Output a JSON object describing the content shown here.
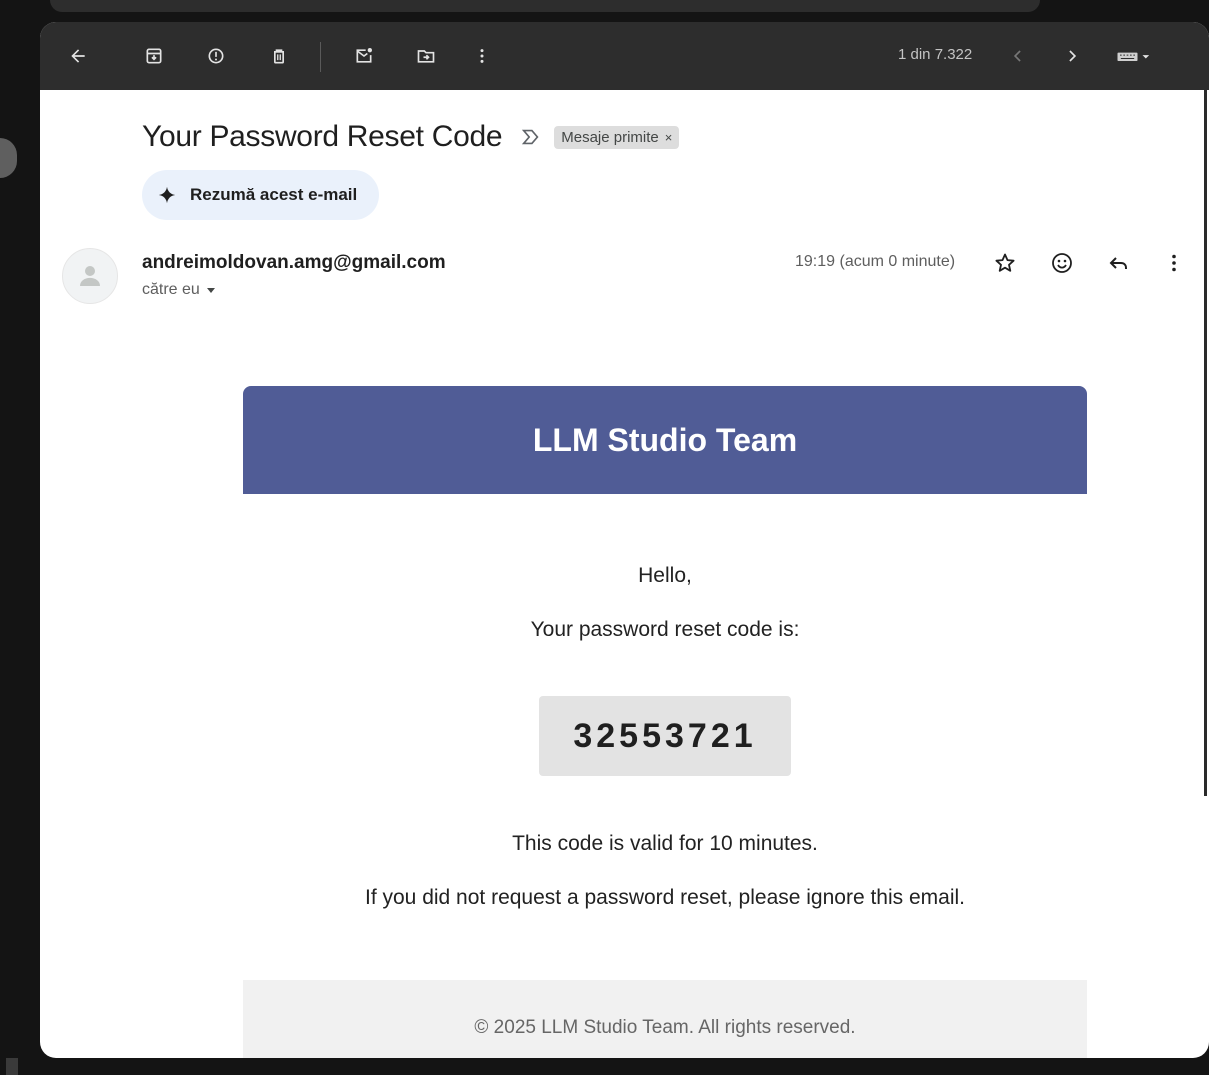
{
  "toolbar": {
    "pager_text": "1 din 7.322"
  },
  "message": {
    "subject": "Your Password Reset Code",
    "label": "Mesaje primite",
    "label_remove": "×",
    "summarize_label": "Rezumă acest e-mail",
    "sender": "andreimoldovan.amg@gmail.com",
    "recipient": "către eu",
    "time": "19:19 (acum 0 minute)"
  },
  "email": {
    "header_title": "LLM Studio Team",
    "greeting": "Hello,",
    "intro": "Your password reset code is:",
    "code": "32553721",
    "validity": "This code is valid for 10 minutes.",
    "ignore_note": "If you did not request a password reset, please ignore this email.",
    "footer": "© 2025 LLM Studio Team. All rights reserved."
  },
  "colors": {
    "toolbar_bg": "#2d2d2d",
    "email_header_bg": "#505c96",
    "summarize_bg": "#eaf1fb",
    "code_bg": "#e3e3e3"
  }
}
